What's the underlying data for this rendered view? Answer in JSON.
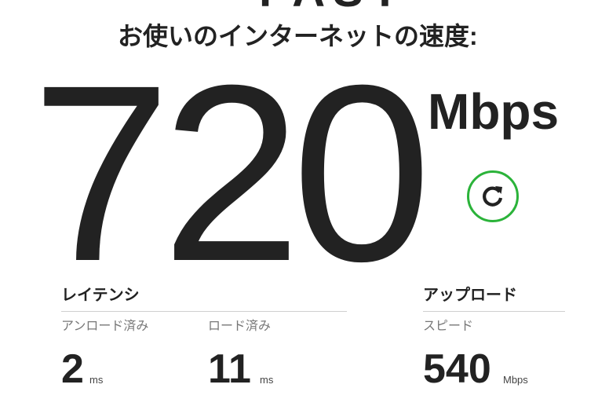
{
  "header": {
    "logo_fragment": "FAST",
    "subtitle": "お使いのインターネットの速度:"
  },
  "speed": {
    "value": "720",
    "unit": "Mbps"
  },
  "refresh": {
    "icon": "refresh-icon",
    "color": "#2bb33a"
  },
  "latency": {
    "title": "レイテンシ",
    "unloaded": {
      "label": "アンロード済み",
      "value": "2",
      "unit": "ms"
    },
    "loaded": {
      "label": "ロード済み",
      "value": "11",
      "unit": "ms"
    }
  },
  "upload": {
    "title": "アップロード",
    "speed": {
      "label": "スピード",
      "value": "540",
      "unit": "Mbps"
    }
  }
}
